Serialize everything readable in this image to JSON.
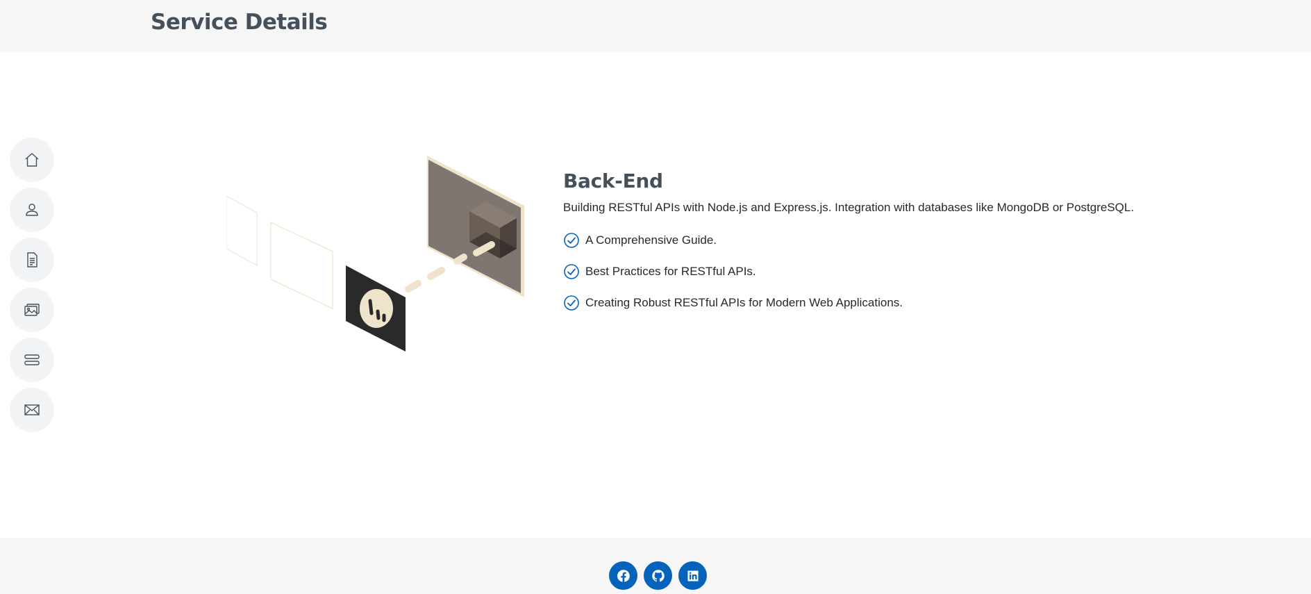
{
  "header": {
    "title": "Service Details"
  },
  "sidebar": {
    "items": [
      {
        "icon": "house-icon"
      },
      {
        "icon": "person-icon"
      },
      {
        "icon": "file-text-icon"
      },
      {
        "icon": "images-icon"
      },
      {
        "icon": "server-icon"
      },
      {
        "icon": "envelope-icon"
      }
    ]
  },
  "service": {
    "title": "Back-End",
    "description": "Building RESTful APIs with Node.js and Express.js. Integration with databases like MongoDB or PostgreSQL.",
    "features": [
      "A Comprehensive Guide.",
      "Best Practices for RESTful APIs.",
      "Creating Robust RESTful APIs for Modern Web Applications."
    ]
  },
  "footer": {
    "social": [
      "facebook-icon",
      "github-icon",
      "linkedin-icon"
    ]
  },
  "colors": {
    "accent": "#0563bb",
    "heading": "#45505b",
    "header_bg": "#f6f6f6"
  }
}
